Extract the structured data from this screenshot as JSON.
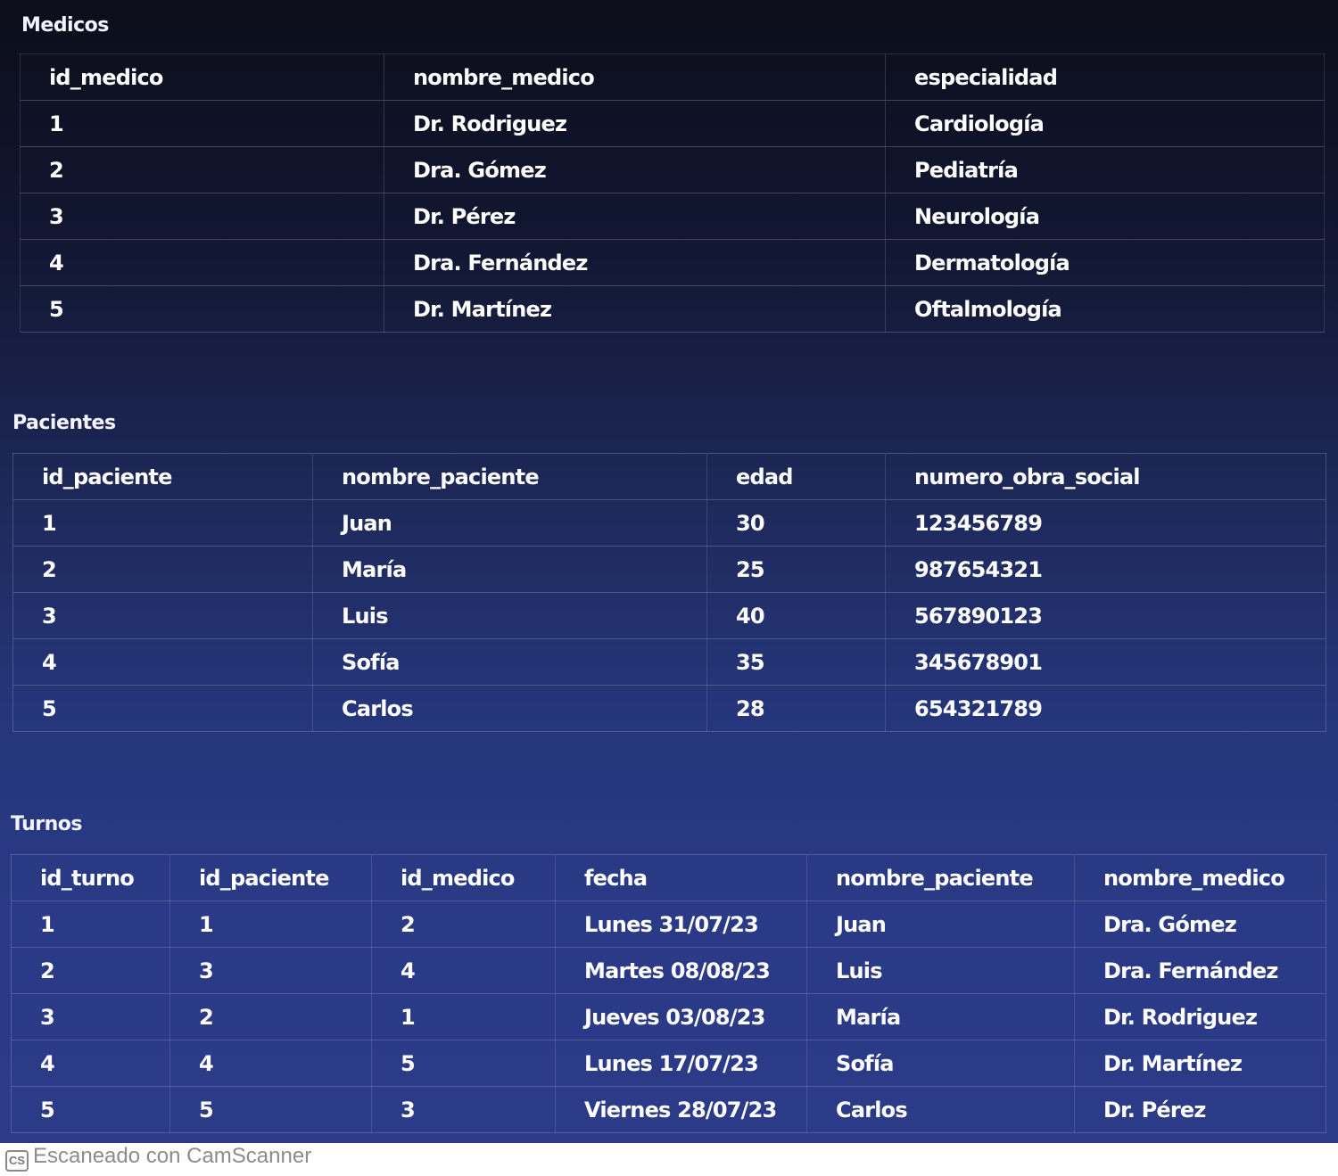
{
  "medicos": {
    "title": "Medicos",
    "columns": [
      "id_medico",
      "nombre_medico",
      "especialidad"
    ],
    "rows": [
      [
        "1",
        "Dr. Rodriguez",
        "Cardiología"
      ],
      [
        "2",
        "Dra. Gómez",
        "Pediatría"
      ],
      [
        "3",
        "Dr. Pérez",
        "Neurología"
      ],
      [
        "4",
        "Dra. Fernández",
        "Dermatología"
      ],
      [
        "5",
        "Dr. Martínez",
        "Oftalmología"
      ]
    ]
  },
  "pacientes": {
    "title": "Pacientes",
    "columns": [
      "id_paciente",
      "nombre_paciente",
      "edad",
      "numero_obra_social"
    ],
    "rows": [
      [
        "1",
        "Juan",
        "30",
        "123456789"
      ],
      [
        "2",
        "María",
        "25",
        "987654321"
      ],
      [
        "3",
        "Luis",
        "40",
        "567890123"
      ],
      [
        "4",
        "Sofía",
        "35",
        "345678901"
      ],
      [
        "5",
        "Carlos",
        "28",
        "654321789"
      ]
    ]
  },
  "turnos": {
    "title": "Turnos",
    "columns": [
      "id_turno",
      "id_paciente",
      "id_medico",
      "fecha",
      "nombre_paciente",
      "nombre_medico"
    ],
    "rows": [
      [
        "1",
        "1",
        "2",
        "Lunes 31/07/23",
        "Juan",
        "Dra. Gómez"
      ],
      [
        "2",
        "3",
        "4",
        "Martes 08/08/23",
        "Luis",
        "Dra. Fernández"
      ],
      [
        "3",
        "2",
        "1",
        "Jueves 03/08/23",
        "María",
        "Dr. Rodriguez"
      ],
      [
        "4",
        "4",
        "5",
        "Lunes 17/07/23",
        "Sofía",
        "Dr. Martínez"
      ],
      [
        "5",
        "5",
        "3",
        "Viernes 28/07/23",
        "Carlos",
        "Dr. Pérez"
      ]
    ]
  },
  "footer": {
    "logo": "CS",
    "text": "Escaneado con CamScanner"
  }
}
